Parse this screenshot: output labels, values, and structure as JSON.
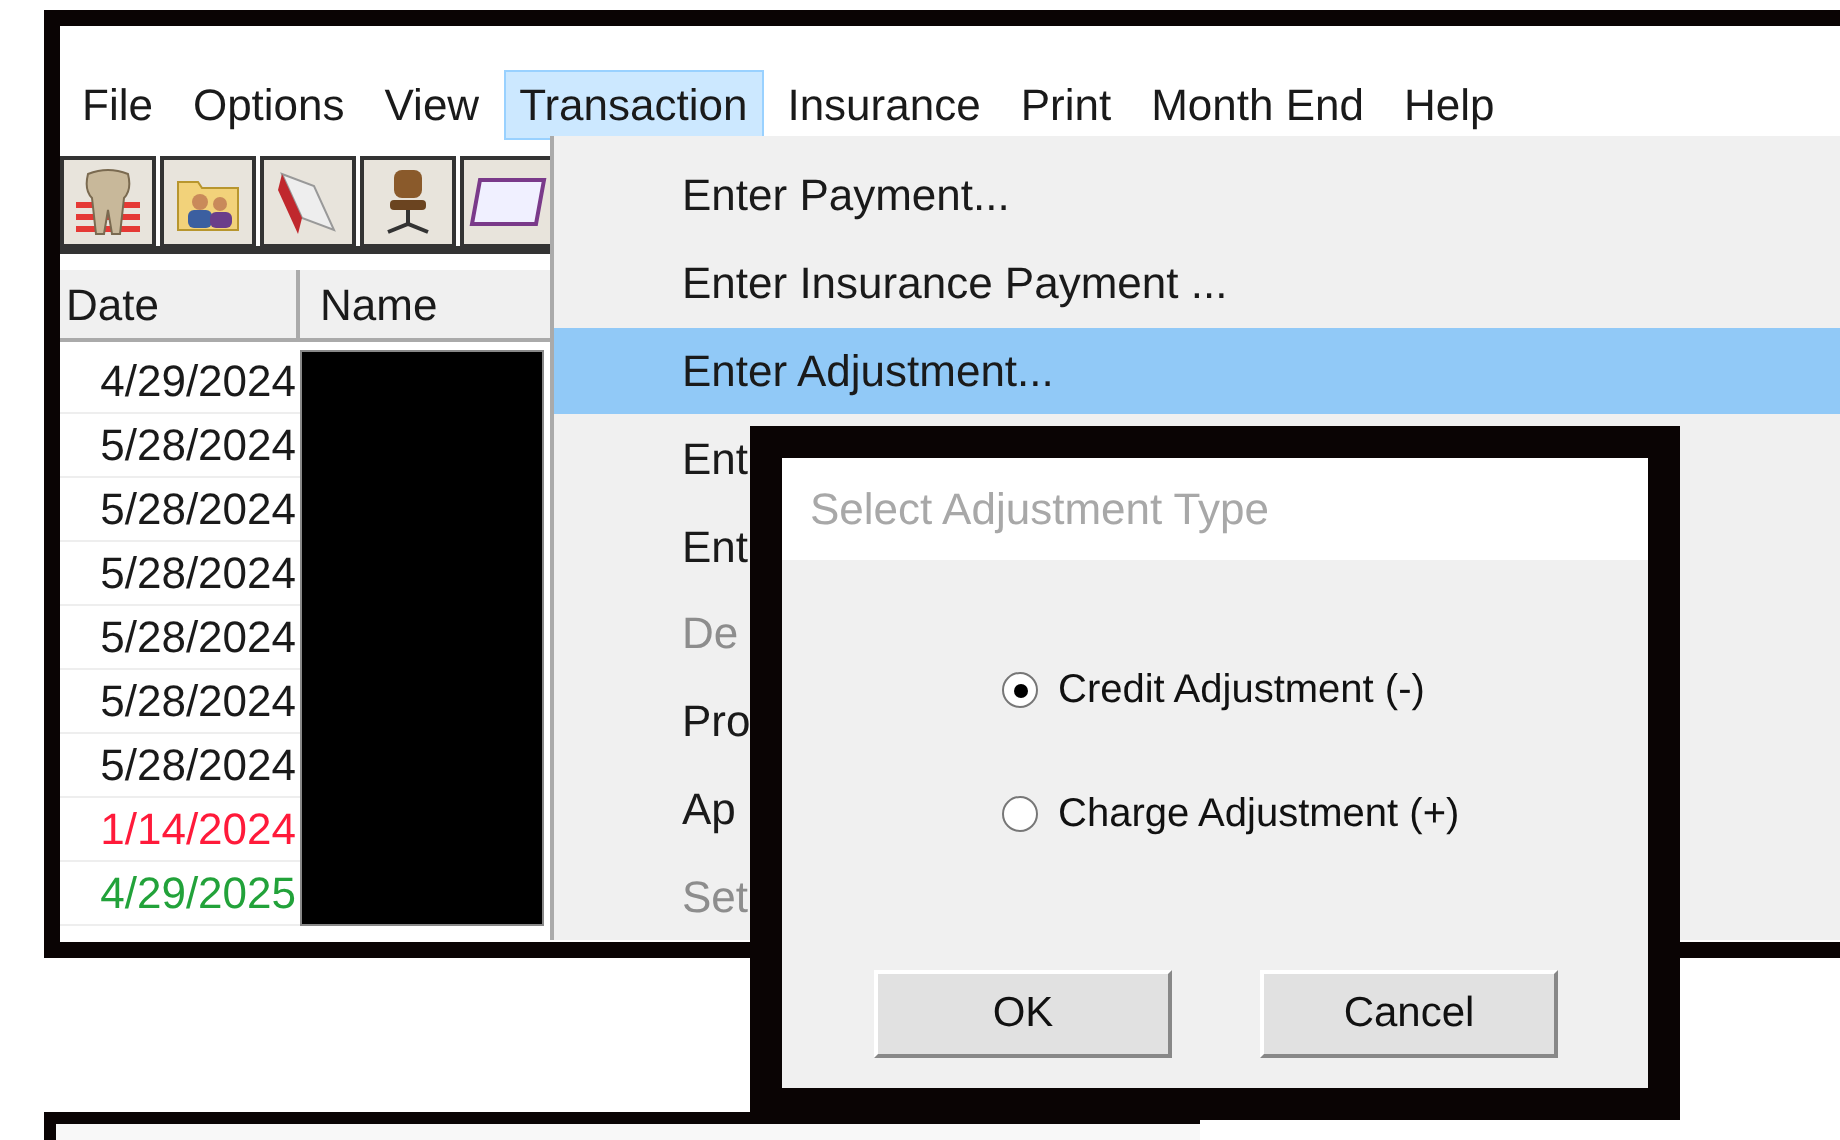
{
  "menu_bar": [
    {
      "label": "File",
      "selected": false
    },
    {
      "label": "Options",
      "selected": false
    },
    {
      "label": "View",
      "selected": false
    },
    {
      "label": "Transaction",
      "selected": true
    },
    {
      "label": "Insurance",
      "selected": false
    },
    {
      "label": "Print",
      "selected": false
    },
    {
      "label": "Month End",
      "selected": false
    },
    {
      "label": "Help",
      "selected": false
    }
  ],
  "table": {
    "columns": [
      "Date",
      "Name"
    ],
    "rows": [
      {
        "date": "4/29/2024",
        "color": "#1a1a1a"
      },
      {
        "date": "5/28/2024",
        "color": "#1a1a1a"
      },
      {
        "date": "5/28/2024",
        "color": "#1a1a1a"
      },
      {
        "date": "5/28/2024",
        "color": "#1a1a1a"
      },
      {
        "date": "5/28/2024",
        "color": "#1a1a1a"
      },
      {
        "date": "5/28/2024",
        "color": "#1a1a1a"
      },
      {
        "date": "5/28/2024",
        "color": "#1a1a1a"
      },
      {
        "date": "1/14/2024",
        "color": "#ff1a3a"
      },
      {
        "date": "4/29/2025",
        "color": "#22a23a"
      }
    ]
  },
  "transaction_menu": {
    "items": [
      {
        "label": "Enter Payment...",
        "selected": false,
        "disabled": false
      },
      {
        "label": "Enter Insurance Payment ...",
        "selected": false,
        "disabled": false
      },
      {
        "label": "Enter Adjustment...",
        "selected": true,
        "disabled": false
      },
      {
        "label": "Ent",
        "selected": false,
        "disabled": false
      },
      {
        "label": "Ent",
        "selected": false,
        "disabled": false
      },
      {
        "label": "De",
        "selected": false,
        "disabled": true
      },
      {
        "label": "Pro",
        "selected": false,
        "disabled": false
      },
      {
        "label": "Ap",
        "selected": false,
        "disabled": false
      },
      {
        "label": "Set",
        "selected": false,
        "disabled": true
      }
    ]
  },
  "dialog": {
    "title": "Select Adjustment Type",
    "options": [
      {
        "label": "Credit Adjustment (-)",
        "selected": true
      },
      {
        "label": "Charge Adjustment (+)",
        "selected": false
      }
    ],
    "buttons": [
      "OK",
      "Cancel"
    ]
  }
}
